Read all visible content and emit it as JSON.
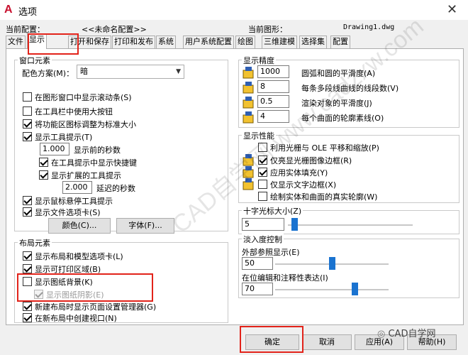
{
  "window": {
    "title": "选项",
    "close": "✕"
  },
  "profile": {
    "label": "当前配置：",
    "value": "<<未命名配置>>",
    "drawing_label": "当前图形：",
    "drawing_value": "Drawing1.dwg"
  },
  "tabs": [
    "文件",
    "显示",
    "打开和保存",
    "打印和发布",
    "系统",
    "用户系统配置",
    "绘图",
    "三维建模",
    "选择集",
    "配置"
  ],
  "window_elements": {
    "title": "窗口元素",
    "color_scheme_label": "配色方案(M)：",
    "color_scheme_value": "暗",
    "options": [
      {
        "label": "在图形窗口中显示滚动条(S)",
        "checked": false
      },
      {
        "label": "在工具栏中使用大按钮",
        "checked": false
      },
      {
        "label": "将功能区图标调整为标准大小",
        "checked": true
      },
      {
        "label": "显示工具提示(T)",
        "checked": true
      }
    ],
    "delay_value": "1.000",
    "delay_label": "显示前的秒数",
    "shortcut_label": "在工具提示中显示快捷键",
    "extended_label": "显示扩展的工具提示",
    "ext_delay_value": "2.000",
    "ext_delay_label": "延迟的秒数",
    "rollover_label": "显示鼠标悬停工具提示",
    "file_tabs_label": "显示文件选项卡(S)",
    "colors_button": "颜色(C)...",
    "fonts_button": "字体(F)..."
  },
  "layout_elements": {
    "title": "布局元素",
    "options": [
      {
        "label": "显示布局和模型选项卡(L)",
        "checked": true
      },
      {
        "label": "显示可打印区域(B)",
        "checked": true
      },
      {
        "label": "显示图纸背景(K)",
        "checked": false
      },
      {
        "label": "显示图纸阴影(E)",
        "checked": true,
        "disabled": true
      },
      {
        "label": "新建布局时显示页面设置管理器(G)",
        "checked": true
      },
      {
        "label": "在新布局中创建视口(N)",
        "checked": true
      }
    ]
  },
  "display_resolution": {
    "title": "显示精度",
    "rows": [
      {
        "value": "1000",
        "label": "圆弧和圆的平滑度(A)"
      },
      {
        "value": "8",
        "label": "每条多段线曲线的线段数(V)"
      },
      {
        "value": "0.5",
        "label": "渲染对象的平滑度(J)"
      },
      {
        "value": "4",
        "label": "每个曲面的轮廓素线(O)"
      }
    ]
  },
  "display_performance": {
    "title": "显示性能",
    "options": [
      {
        "label": "利用光栅与 OLE 平移和缩放(P)",
        "checked": false
      },
      {
        "label": "仅亮显光栅图像边框(R)",
        "checked": true
      },
      {
        "label": "应用实体填充(Y)",
        "checked": true
      },
      {
        "label": "仅显示文字边框(X)",
        "checked": false
      },
      {
        "label": "绘制实体和曲面的真实轮廓(W)",
        "checked": false
      }
    ]
  },
  "crosshair": {
    "title": "十字光标大小(Z)",
    "value": "5",
    "level": 0.05
  },
  "fade": {
    "title": "淡入度控制",
    "xref_label": "外部参照显示(E)",
    "xref_value": "50",
    "xref_level": 0.5,
    "inplace_label": "在位编辑和注释性表达(I)",
    "inplace_value": "70",
    "inplace_level": 0.7
  },
  "buttons": {
    "ok": "确定",
    "cancel": "取消",
    "apply": "应用(A)",
    "help": "帮助(H)"
  },
  "watermark": "CAD自学网 www.cadzxw.com",
  "brand": "CAD自学网",
  "colors": {
    "accent": "#1a73d0",
    "highlight": "#e2231a",
    "app_icon": "#c8102e"
  }
}
